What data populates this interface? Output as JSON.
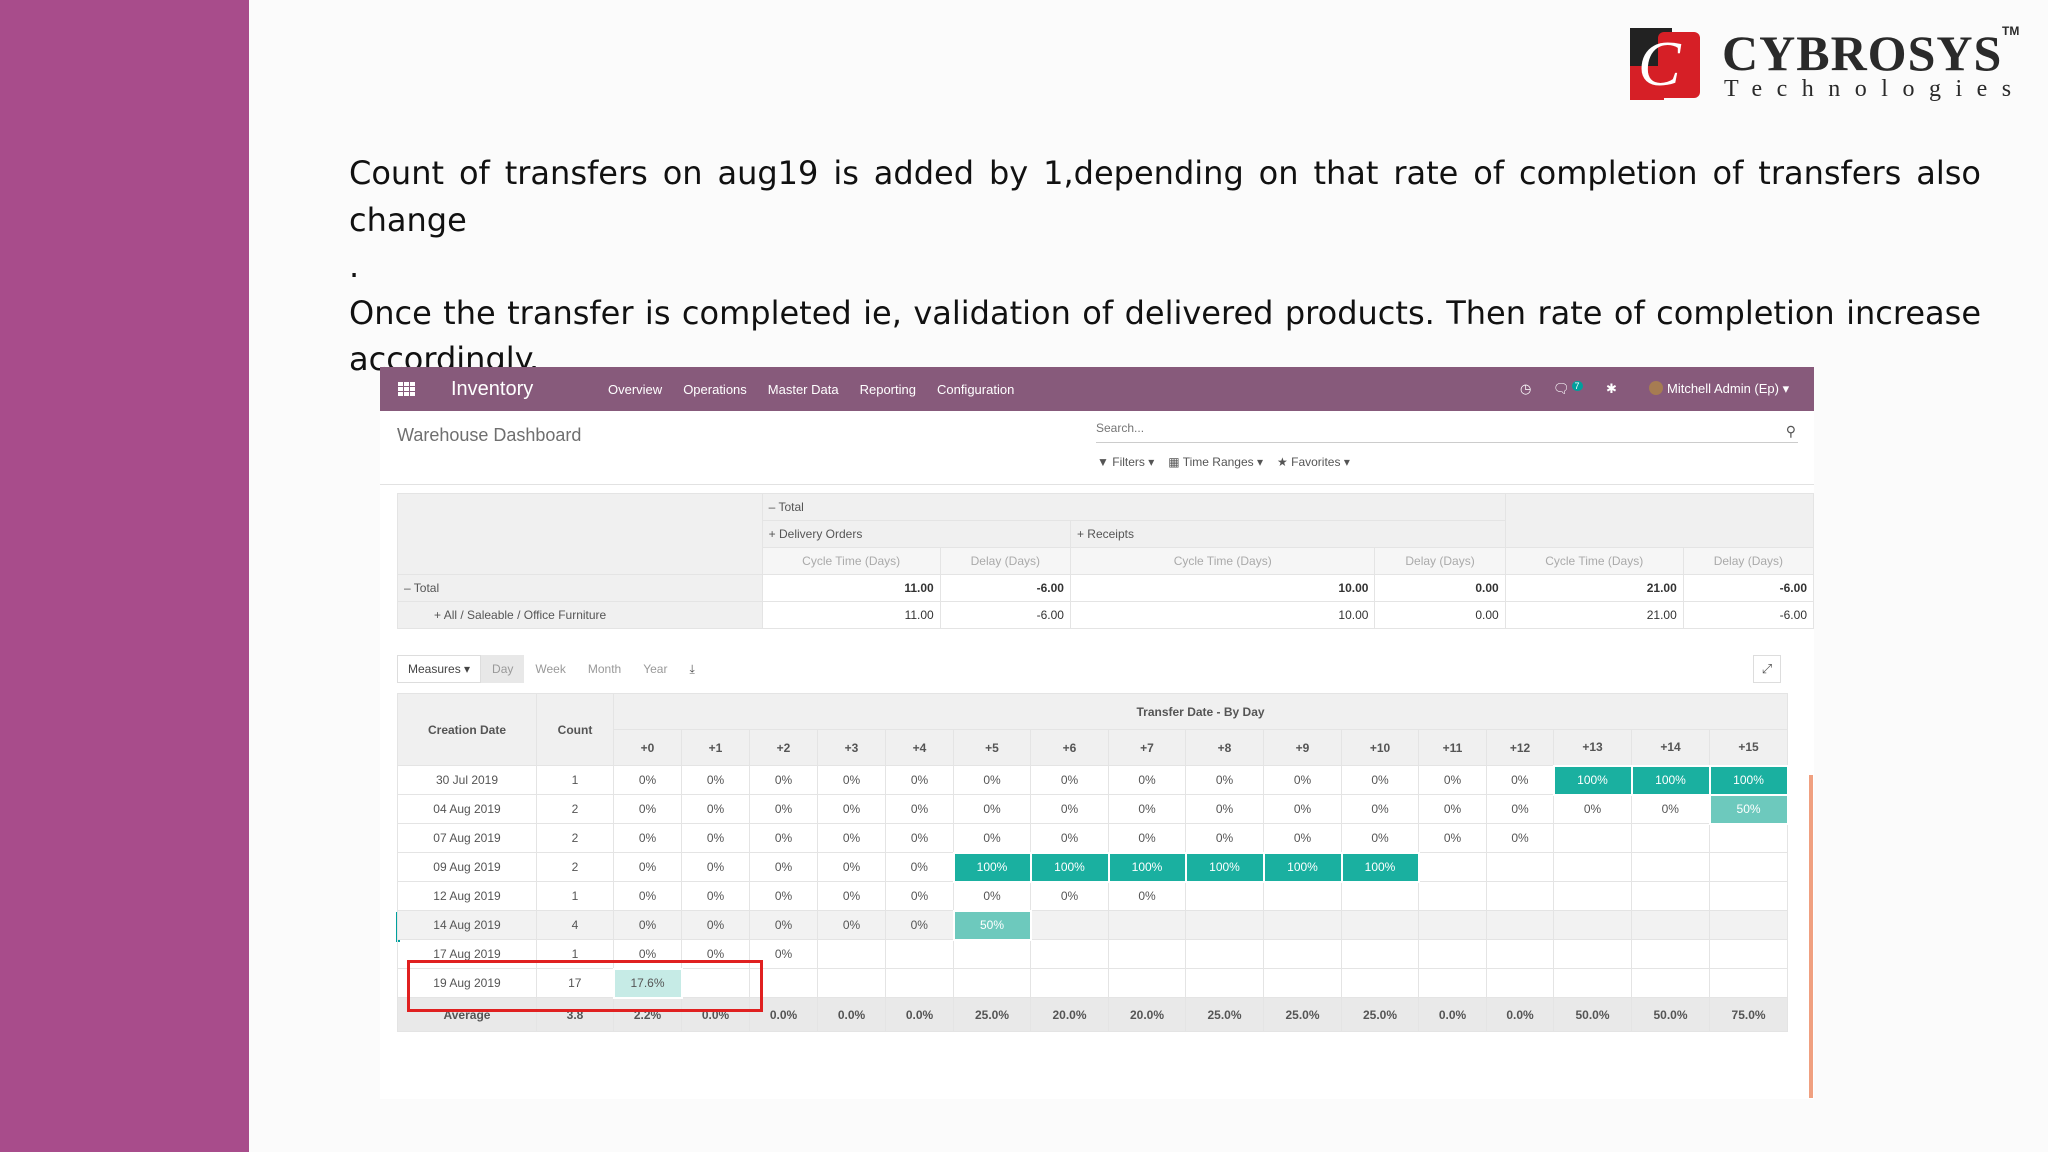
{
  "logo": {
    "title": "CYBROSYS",
    "tm": "TM",
    "subtitle": "Technologies"
  },
  "slide": {
    "line1": "Count of transfers on aug19 is added by 1,depending on that rate of completion of transfers also change",
    "line2": ".",
    "line3": "Once  the transfer is completed ie, validation of delivered products. Then rate of completion  increase accordingly."
  },
  "topbar": {
    "app_name": "Inventory",
    "menu": [
      "Overview",
      "Operations",
      "Master Data",
      "Reporting",
      "Configuration"
    ],
    "messages_count": "7",
    "user": "Mitchell Admin (Ep)"
  },
  "control_panel": {
    "breadcrumb": "Warehouse Dashboard",
    "search_placeholder": "Search...",
    "filters": "Filters",
    "time_ranges": "Time Ranges",
    "favorites": "Favorites"
  },
  "pivot": {
    "col_total": "Total",
    "col_delivery": "Delivery Orders",
    "col_receipts": "Receipts",
    "measures": [
      "Cycle Time (Days)",
      "Delay (Days)",
      "Cycle Time (Days)",
      "Delay (Days)",
      "Cycle Time (Days)",
      "Delay (Days)"
    ],
    "rows": [
      {
        "label": "Total",
        "values": [
          "11.00",
          "-6.00",
          "10.00",
          "0.00",
          "21.00",
          "-6.00"
        ]
      },
      {
        "label": "All / Saleable / Office Furniture",
        "values": [
          "11.00",
          "-6.00",
          "10.00",
          "0.00",
          "21.00",
          "-6.00"
        ]
      }
    ]
  },
  "cohort_toolbar": {
    "measures": "Measures",
    "intervals": [
      "Day",
      "Week",
      "Month",
      "Year"
    ]
  },
  "cohort": {
    "col_creation": "Creation Date",
    "col_count": "Count",
    "group_title": "Transfer Date - By Day",
    "day_cols": [
      "+0",
      "+1",
      "+2",
      "+3",
      "+4",
      "+5",
      "+6",
      "+7",
      "+8",
      "+9",
      "+10",
      "+11",
      "+12",
      "+13",
      "+14",
      "+15"
    ],
    "rows": [
      {
        "date": "30 Jul 2019",
        "count": "1",
        "cells": [
          "0%",
          "0%",
          "0%",
          "0%",
          "0%",
          "0%",
          "0%",
          "0%",
          "0%",
          "0%",
          "0%",
          "0%",
          "0%",
          "100%",
          "100%",
          "100%"
        ]
      },
      {
        "date": "04 Aug 2019",
        "count": "2",
        "cells": [
          "0%",
          "0%",
          "0%",
          "0%",
          "0%",
          "0%",
          "0%",
          "0%",
          "0%",
          "0%",
          "0%",
          "0%",
          "0%",
          "0%",
          "0%",
          "50%"
        ]
      },
      {
        "date": "07 Aug 2019",
        "count": "2",
        "cells": [
          "0%",
          "0%",
          "0%",
          "0%",
          "0%",
          "0%",
          "0%",
          "0%",
          "0%",
          "0%",
          "0%",
          "0%",
          "0%",
          "",
          "",
          ""
        ]
      },
      {
        "date": "09 Aug 2019",
        "count": "2",
        "cells": [
          "0%",
          "0%",
          "0%",
          "0%",
          "0%",
          "100%",
          "100%",
          "100%",
          "100%",
          "100%",
          "100%",
          "",
          "",
          "",
          "",
          ""
        ]
      },
      {
        "date": "12 Aug 2019",
        "count": "1",
        "cells": [
          "0%",
          "0%",
          "0%",
          "0%",
          "0%",
          "0%",
          "0%",
          "0%",
          "",
          "",
          "",
          "",
          "",
          "",
          "",
          ""
        ]
      },
      {
        "date": "14 Aug 2019",
        "count": "4",
        "cells": [
          "0%",
          "0%",
          "0%",
          "0%",
          "0%",
          "50%",
          "",
          "",
          "",
          "",
          "",
          "",
          "",
          "",
          "",
          ""
        ]
      },
      {
        "date": "17 Aug 2019",
        "count": "1",
        "cells": [
          "0%",
          "0%",
          "0%",
          "",
          "",
          "",
          "",
          "",
          "",
          "",
          "",
          "",
          "",
          "",
          "",
          ""
        ]
      },
      {
        "date": "19 Aug 2019",
        "count": "17",
        "cells": [
          "17.6%",
          "",
          "",
          "",
          "",
          "",
          "",
          "",
          "",
          "",
          "",
          "",
          "",
          "",
          "",
          ""
        ]
      }
    ],
    "footer": {
      "label": "Average",
      "count": "3.8",
      "cells": [
        "2.2%",
        "0.0%",
        "0.0%",
        "0.0%",
        "0.0%",
        "25.0%",
        "20.0%",
        "20.0%",
        "25.0%",
        "25.0%",
        "25.0%",
        "0.0%",
        "0.0%",
        "50.0%",
        "50.0%",
        "75.0%"
      ]
    }
  },
  "colors": {
    "brand": "#875a7b",
    "slide_bar": "#a84c8b",
    "accent": "#00a09d",
    "highlight_box": "#e02020"
  }
}
